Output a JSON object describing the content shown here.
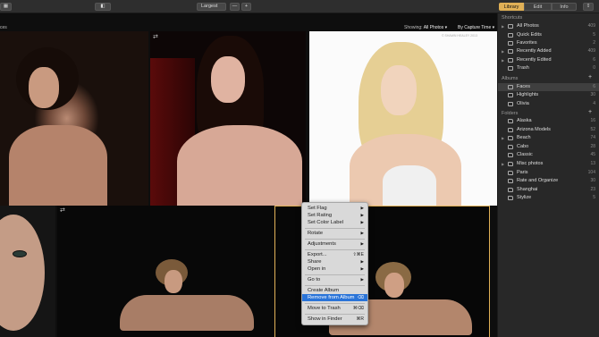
{
  "toolbar": {
    "view_icon": "grid-view-icon",
    "sidebar_icon": "sidebar-toggle-icon",
    "zoom_label": "Largest",
    "zoom_minus": "—",
    "zoom_plus": "+",
    "tabs": [
      "Library",
      "Edit",
      "Info"
    ],
    "share_icon": "share-icon",
    "accent": "#e0b056"
  },
  "subbar": {
    "crumb": "ces",
    "showing_label": "Showing:",
    "showing_value": "All Photos ▾",
    "sort_value": "By Capture Time ▾"
  },
  "photos": {
    "watermark": "© SHAWN HEALEY 2013",
    "stars": "★★★★★",
    "flag_icon": "♡"
  },
  "context_menu": {
    "items": [
      {
        "label": "Set Flag",
        "submenu": true
      },
      {
        "label": "Set Rating",
        "submenu": true
      },
      {
        "label": "Set Color Label",
        "submenu": true
      },
      {
        "label": "Rotate",
        "submenu": true
      },
      {
        "label": "Adjustments",
        "submenu": true
      },
      {
        "label": "Export...",
        "shortcut": "⇧⌘E"
      },
      {
        "label": "Share",
        "submenu": true
      },
      {
        "label": "Open in",
        "submenu": true
      },
      {
        "label": "Go to",
        "submenu": true
      },
      {
        "label": "Create Album"
      },
      {
        "label": "Remove from Album",
        "shortcut": "⌫",
        "highlighted": true
      },
      {
        "label": "Move to Trash",
        "shortcut": "⌘⌫"
      },
      {
        "label": "Show in Finder",
        "shortcut": "⌘R"
      }
    ]
  },
  "sidebar": {
    "shortcuts_title": "Shortcuts",
    "shortcuts": [
      {
        "label": "All Photos",
        "count": "409"
      },
      {
        "label": "Quick Edits",
        "count": "5"
      },
      {
        "label": "Favorites",
        "count": "2"
      },
      {
        "label": "Recently Added",
        "count": "409"
      },
      {
        "label": "Recently Edited",
        "count": "6"
      },
      {
        "label": "Trash",
        "count": "0"
      }
    ],
    "albums_title": "Albums",
    "albums": [
      {
        "label": "Faces",
        "count": "6"
      },
      {
        "label": "Highlights",
        "count": "30"
      },
      {
        "label": "Olivia",
        "count": "4"
      }
    ],
    "folders_title": "Folders",
    "folders": [
      {
        "label": "Alaska",
        "count": "16"
      },
      {
        "label": "Arizona Models",
        "count": "52"
      },
      {
        "label": "Beach",
        "count": "74"
      },
      {
        "label": "Cabo",
        "count": "28"
      },
      {
        "label": "Classic",
        "count": "45"
      },
      {
        "label": "Misc photos",
        "count": "13"
      },
      {
        "label": "Paris",
        "count": "104"
      },
      {
        "label": "Rate and Organize",
        "count": "30"
      },
      {
        "label": "Shanghai",
        "count": "23"
      },
      {
        "label": "Stylize",
        "count": "5"
      }
    ],
    "add": "+"
  }
}
